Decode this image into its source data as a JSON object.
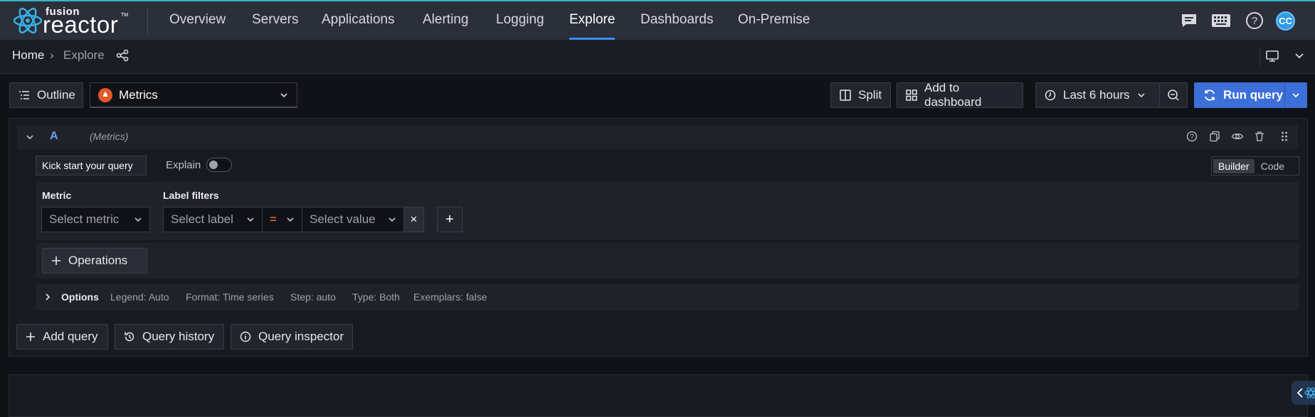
{
  "brand": {
    "small": "fusion",
    "big": "reactor",
    "tm": "TM"
  },
  "nav": {
    "items": [
      {
        "label": "Overview"
      },
      {
        "label": "Servers"
      },
      {
        "label": "Applications"
      },
      {
        "label": "Alerting"
      },
      {
        "label": "Logging"
      },
      {
        "label": "Explore",
        "active": true
      },
      {
        "label": "Dashboards"
      },
      {
        "label": "On-Premise"
      }
    ],
    "icons": [
      "chat-icon",
      "keyboard-icon",
      "help-icon"
    ],
    "avatar_initials": "CC"
  },
  "breadcrumb": {
    "home": "Home",
    "separator": "›",
    "current": "Explore"
  },
  "toolbar": {
    "outline_label": "Outline",
    "datasource": "Metrics",
    "split_label": "Split",
    "add_to_dashboard_label": "Add to dashboard",
    "time_range": "Last 6 hours",
    "run_query_label": "Run query"
  },
  "query": {
    "letter": "A",
    "datasource": "(Metrics)",
    "kickstart_label": "Kick start your query",
    "explain_label": "Explain",
    "explain_enabled": false,
    "mode_builder": "Builder",
    "mode_code": "Code",
    "mode_selected": "Builder",
    "metric_label": "Metric",
    "metric_placeholder": "Select metric",
    "label_filters_label": "Label filters",
    "label_placeholder": "Select label",
    "operator": "=",
    "value_placeholder": "Select value",
    "remove_symbol": "×",
    "add_symbol": "+",
    "operations_label": "Operations",
    "options": {
      "title": "Options",
      "legend": "Legend: Auto",
      "format": "Format: Time series",
      "step": "Step: auto",
      "type": "Type: Both",
      "exemplars": "Exemplars: false"
    }
  },
  "actions": {
    "add_query": "Add query",
    "query_history": "Query history",
    "query_inspector": "Query inspector"
  },
  "colors": {
    "accent": "#3d8df2",
    "primary_button": "#3d6fd9",
    "operator": "#f08b3a",
    "datasource_icon": "#e05a2b"
  }
}
